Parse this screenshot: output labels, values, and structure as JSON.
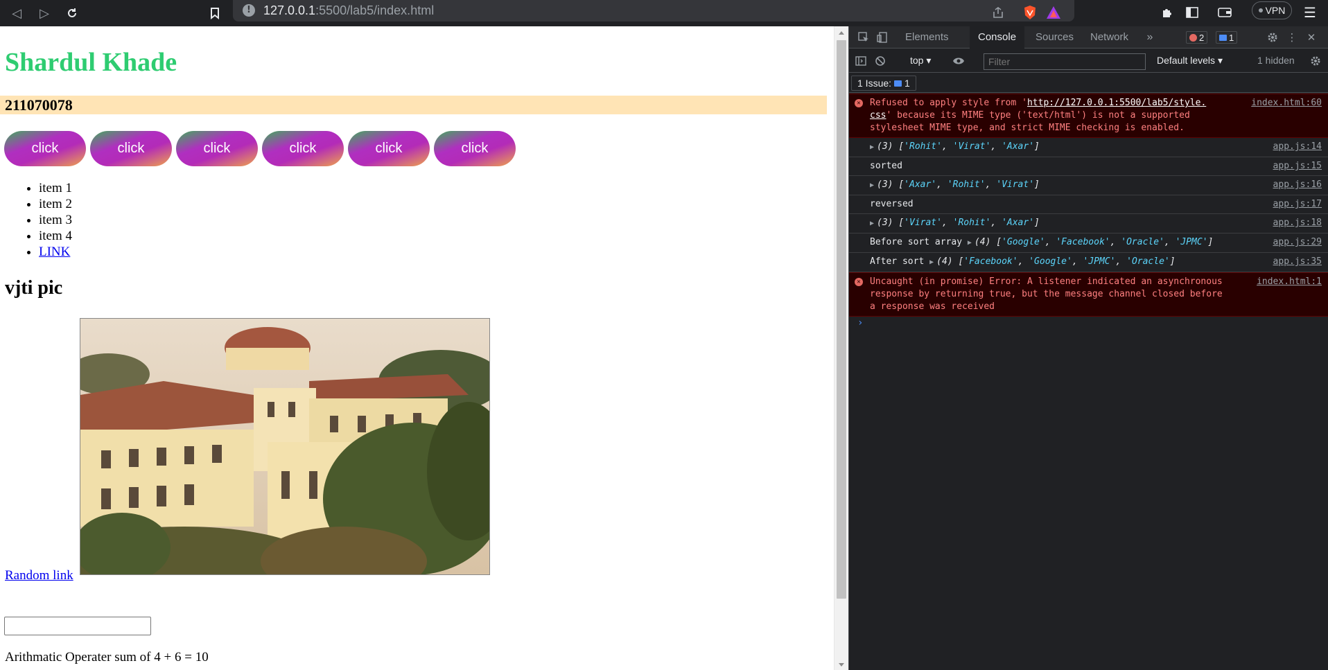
{
  "browser": {
    "url_host": "127.0.0.1",
    "url_rest": ":5500/lab5/index.html",
    "vpn_label": "VPN",
    "icons": [
      "back-icon",
      "forward-icon",
      "reload-icon",
      "bookmark-icon",
      "info-icon",
      "share-icon",
      "brave-shield-icon",
      "brave-rewards-icon",
      "extensions-icon",
      "sidebar-icon",
      "wallet-icon",
      "menu-icon"
    ]
  },
  "page": {
    "title": "Shardul Khade",
    "roll_number": "211070078",
    "buttons": [
      "click",
      "click",
      "click",
      "click",
      "click",
      "click"
    ],
    "list_items": [
      "item 1",
      "item 2",
      "item 3",
      "item 4"
    ],
    "list_link": "LINK",
    "pic_heading": "vjti pic",
    "random_link": "Random link",
    "input_value": "",
    "arithmetic_text": "Arithmatic Operater sum of 4 + 6 = 10"
  },
  "devtools": {
    "tabs": [
      "Elements",
      "Console",
      "Sources",
      "Network"
    ],
    "active_tab": "Console",
    "error_count": "2",
    "message_count": "1",
    "context": "top",
    "filter_placeholder": "Filter",
    "levels": "Default levels",
    "hidden": "1 hidden",
    "issues_label": "1 Issue:",
    "issues_count": "1",
    "messages": [
      {
        "type": "error",
        "source": "index.html:60"
      },
      {
        "type": "log",
        "source": "app.js:14"
      },
      {
        "type": "log",
        "text": "sorted",
        "source": "app.js:15"
      },
      {
        "type": "log",
        "source": "app.js:16"
      },
      {
        "type": "log",
        "text": "reversed",
        "source": "app.js:17"
      },
      {
        "type": "log",
        "source": "app.js:18"
      },
      {
        "type": "log",
        "source": "app.js:29"
      },
      {
        "type": "log",
        "source": "app.js:35"
      },
      {
        "type": "error",
        "source": "index.html:1"
      }
    ],
    "error1": {
      "prefix": "Refused to apply style from '",
      "url1": "http://127.0.0.1:5500/lab5/style.",
      "url2": "css",
      "suffix": "' because its MIME type ('text/html') is not a supported stylesheet MIME type, and strict MIME checking is enabled."
    },
    "arrays": {
      "a14": {
        "count": "(3)",
        "items": [
          "'Rohit'",
          "'Virat'",
          "'Axar'"
        ]
      },
      "a16": {
        "count": "(3)",
        "items": [
          "'Axar'",
          "'Rohit'",
          "'Virat'"
        ]
      },
      "a18": {
        "count": "(3)",
        "items": [
          "'Virat'",
          "'Rohit'",
          "'Axar'"
        ]
      },
      "a29_label": "Before sort array",
      "a29": {
        "count": "(4)",
        "items": [
          "'Google'",
          "'Facebook'",
          "'Oracle'",
          "'JPMC'"
        ]
      },
      "a35_label": "After sort",
      "a35": {
        "count": "(4)",
        "items": [
          "'Facebook'",
          "'Google'",
          "'JPMC'",
          "'Oracle'"
        ]
      }
    },
    "error2": "Uncaught (in promise) Error: A listener indicated an asynchronous response by returning true, but the message channel closed before a response was received"
  },
  "colors": {
    "title_green": "#2ecc71",
    "roll_bg": "#ffe4b5",
    "button_gradient": [
      "#3fae5a",
      "#b02fc0",
      "#f0a54a"
    ],
    "link_blue": "#0000ee",
    "devtools_bg": "#202124",
    "error_bg": "#290000",
    "error_text": "#ff8080",
    "string_cyan": "#5cd5fb"
  }
}
